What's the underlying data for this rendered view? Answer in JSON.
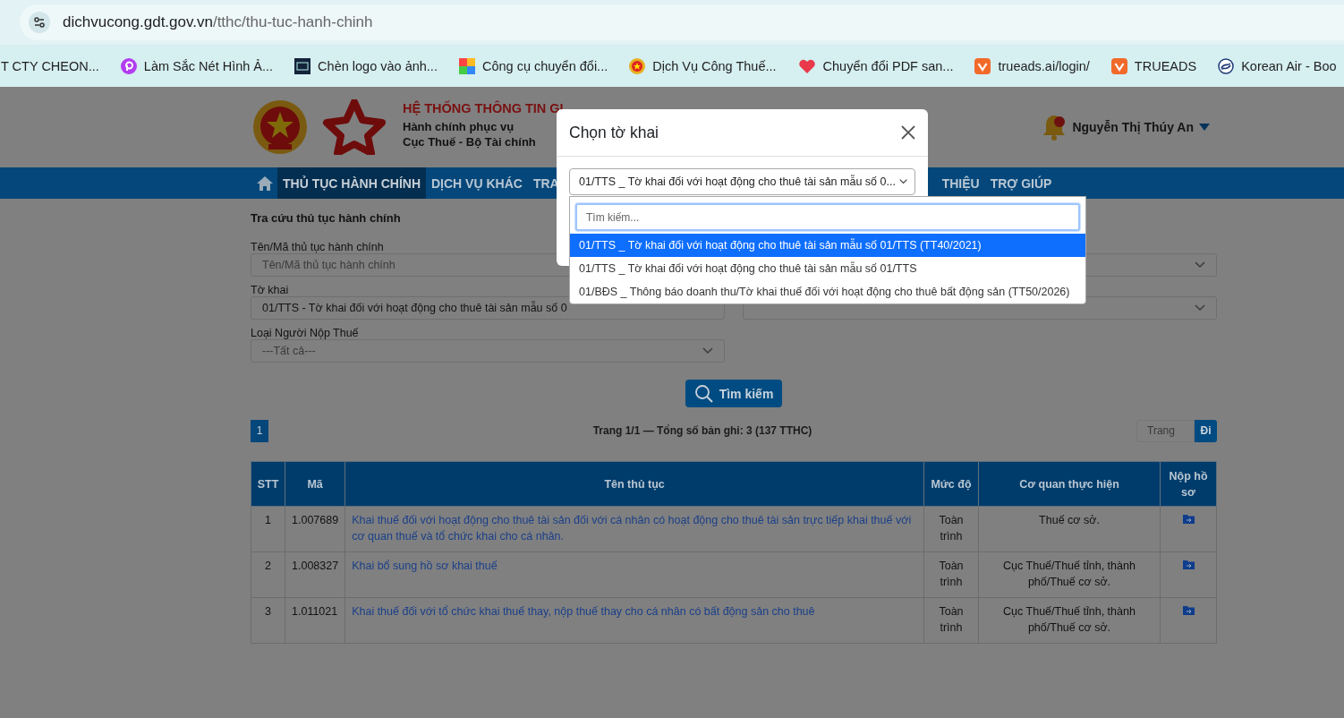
{
  "browser": {
    "url_host": "dichvucong.gdt.gov.vn",
    "url_path": "/tthc/thu-tuc-hanh-chinh",
    "bookmarks": [
      {
        "label": "T CTY CHEON...",
        "kind": "none"
      },
      {
        "label": "Làm Sắc Nét Hình Ả...",
        "kind": "purple"
      },
      {
        "label": "Chèn logo vào ảnh...",
        "kind": "dark"
      },
      {
        "label": "Công cụ chuyển đổi...",
        "kind": "grid"
      },
      {
        "label": "Dịch Vụ Công Thuế...",
        "kind": "emblem"
      },
      {
        "label": "Chuyển đổi PDF san...",
        "kind": "heart"
      },
      {
        "label": "trueads.ai/login/",
        "kind": "orange"
      },
      {
        "label": "TRUEADS",
        "kind": "orange"
      },
      {
        "label": "Korean Air - Boo",
        "kind": "swirl"
      }
    ]
  },
  "header": {
    "title": "HỆ THỐNG THÔNG TIN GI",
    "subtitle_1": "Hành chính phục vụ",
    "subtitle_2": "Cục Thuế - Bộ Tài chính",
    "user": "Nguyễn Thị Thúy An"
  },
  "nav": [
    {
      "label": "THỦ TỤC HÀNH CHÍNH",
      "selected": true
    },
    {
      "label": "DỊCH VỤ KHÁC",
      "selected": false
    },
    {
      "label": "TRA",
      "selected": false
    },
    {
      "label": "THIỆU",
      "selected": false
    },
    {
      "label": "TRỢ GIÚP",
      "selected": false
    }
  ],
  "search_form": {
    "title": "Tra cứu thủ tục hành chính",
    "name_label": "Tên/Mã thủ tục hành chính",
    "name_placeholder": "Tên/Mã thủ tục hành chính",
    "form_label": "Tờ khai",
    "form_value": "01/TTS - Tờ khai đối với hoạt động cho thuê tài sản mẫu số 0",
    "payer_label": "Loại Người Nộp Thuế",
    "payer_value": "---Tất cả---",
    "search_button": "Tìm kiếm"
  },
  "pagination": {
    "pages": [
      {
        "label": "1",
        "selected": true
      }
    ],
    "summary": "Trang 1/1 — Tổng số bản ghi: 3 (137 TTHC)",
    "page_placeholder": "Trang",
    "go_button": "Đi"
  },
  "table": {
    "columns": [
      "STT",
      "Mã",
      "Tên thủ tục",
      "Mức độ",
      "Cơ quan thực hiện",
      "Nộp hồ sơ"
    ],
    "rows": [
      {
        "stt": "1",
        "code": "1.007689",
        "name": "Khai thuế đối với hoạt động cho thuê tài sản đối với cá nhân có hoạt động cho thuê tài sản trực tiếp khai thuế với cơ quan thuế và tổ chức khai cho cá nhân.",
        "level": "Toàn trình",
        "agency": "Thuế cơ sở."
      },
      {
        "stt": "2",
        "code": "1.008327",
        "name": "Khai bổ sung hồ sơ khai thuế",
        "level": "Toàn trình",
        "agency": "Cục Thuế/Thuế tỉnh, thành phố/Thuế cơ sở."
      },
      {
        "stt": "3",
        "code": "1.011021",
        "name": "Khai thuế đối với tổ chức khai thuế thay, nộp thuế thay cho cá nhân có bất động sản cho thuê",
        "level": "Toàn trình",
        "agency": "Cục Thuế/Thuế tỉnh, thành phố/Thuế cơ sở."
      }
    ]
  },
  "modal": {
    "title": "Chọn tờ khai",
    "select_value": "01/TTS _ Tờ khai đối với hoạt động cho thuê tài sản mẫu số 0...",
    "search_placeholder": "Tìm kiếm...",
    "options": [
      {
        "label": "01/TTS _ Tờ khai đối với hoạt động cho thuê tài sản mẫu số 01/TTS (TT40/2021)",
        "selected": true
      },
      {
        "label": "01/TTS _ Tờ khai đối với hoạt động cho thuê tài sản mẫu số 01/TTS",
        "selected": false
      },
      {
        "label": "01/BĐS _ Thông báo doanh thu/Tờ khai thuế đối với hoạt động cho thuê bất động sản (TT50/2026)",
        "selected": false
      }
    ]
  }
}
